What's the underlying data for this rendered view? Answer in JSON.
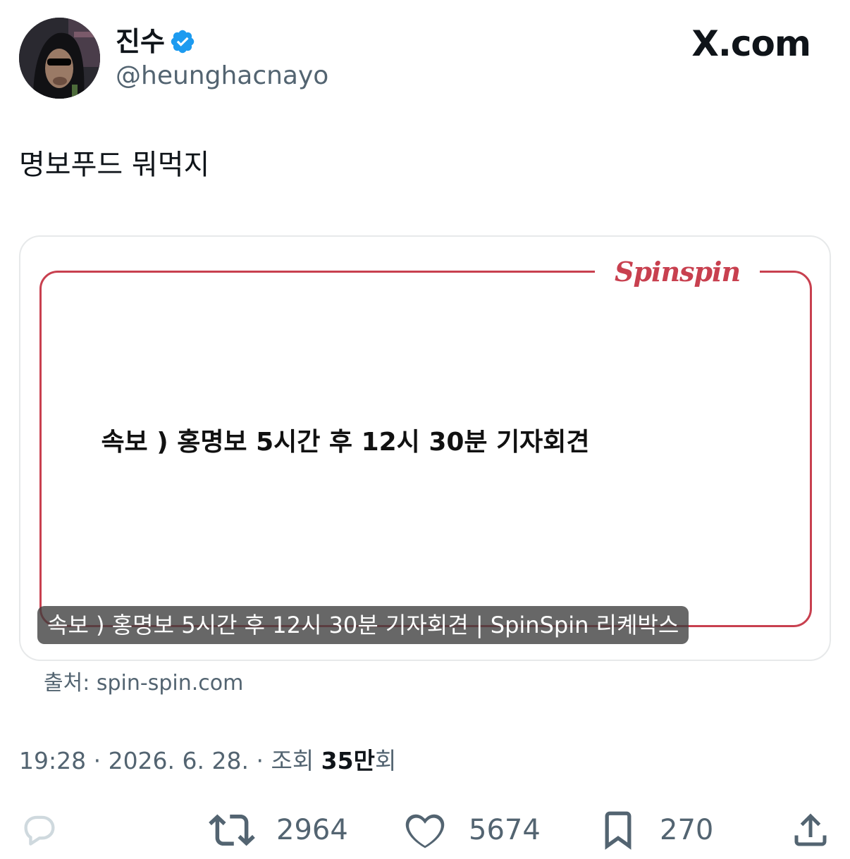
{
  "author": {
    "name": "진수",
    "handle": "@heunghacnayo",
    "verified": true,
    "avatar_icon": "avatar-image"
  },
  "brand": "X.com",
  "tweet": {
    "text": "명보푸드 뭐먹지"
  },
  "card": {
    "logo_text": "Spinspin",
    "headline": "속보 ) 홍명보 5시간 후 12시 30분 기자회견",
    "caption": "속보 ) 홍명보 5시간 후 12시 30분 기자회견 | SpinSpin 리켸박스",
    "accent_color": "#c8404f"
  },
  "source": "출처: spin-spin.com",
  "meta": {
    "time_date": "19:28 · 2026. 6. 28. · 조회 ",
    "views_number": "35만",
    "views_suffix": "회"
  },
  "actions": {
    "reply": {
      "icon": "reply-icon",
      "count": ""
    },
    "retweet": {
      "icon": "retweet-icon",
      "count": "2964"
    },
    "like": {
      "icon": "heart-icon",
      "count": "5674"
    },
    "bookmark": {
      "icon": "bookmark-icon",
      "count": "270"
    },
    "share": {
      "icon": "share-icon"
    }
  },
  "colors": {
    "verified": "#1d9bf0",
    "muted": "#536471",
    "text": "#0f1419"
  }
}
